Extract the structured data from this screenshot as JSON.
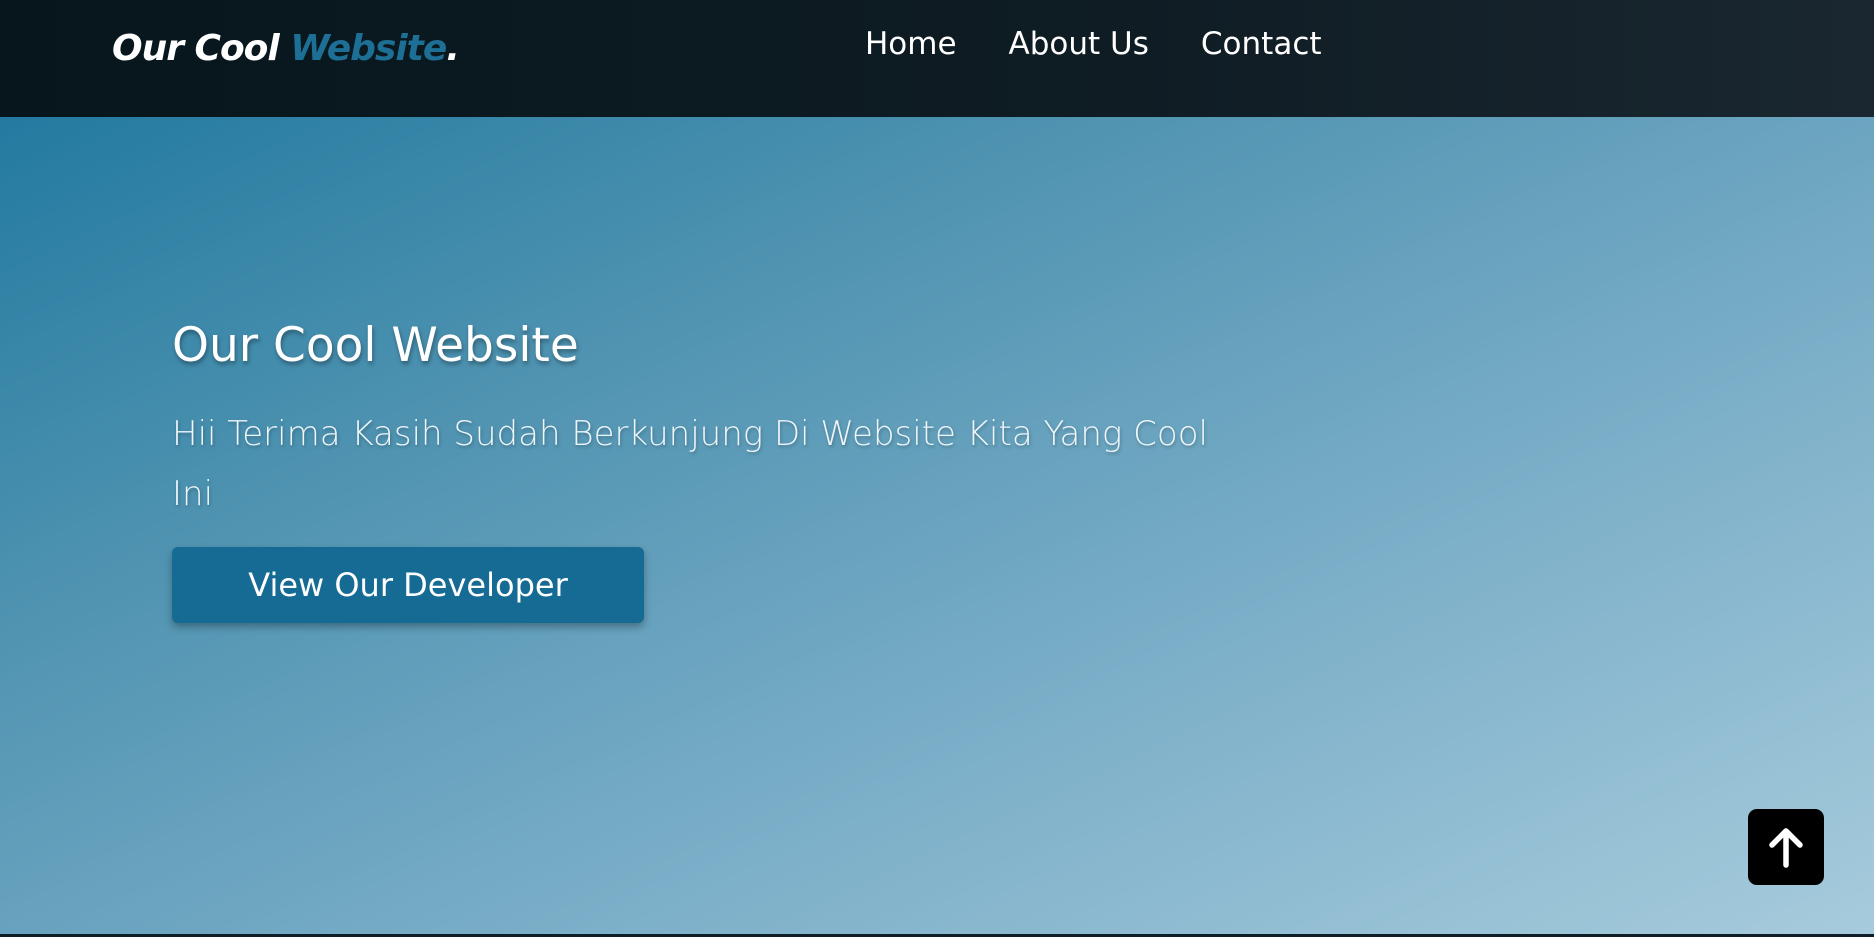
{
  "header": {
    "logo_main": "Our Cool",
    "logo_accent": "Website",
    "logo_dot": ".",
    "nav": [
      {
        "label": "Home"
      },
      {
        "label": "About Us"
      },
      {
        "label": "Contact"
      }
    ]
  },
  "hero": {
    "title": "Our Cool Website",
    "subtitle": "Hii Terima Kasih Sudah Berkunjung Di Website Kita Yang Cool Ini",
    "cta_label": "View Our Developer"
  },
  "back_to_top": {
    "icon": "arrow-up-icon"
  },
  "colors": {
    "accent": "#1d6f95",
    "button": "#156b94",
    "navbar": "#0b1a22"
  }
}
